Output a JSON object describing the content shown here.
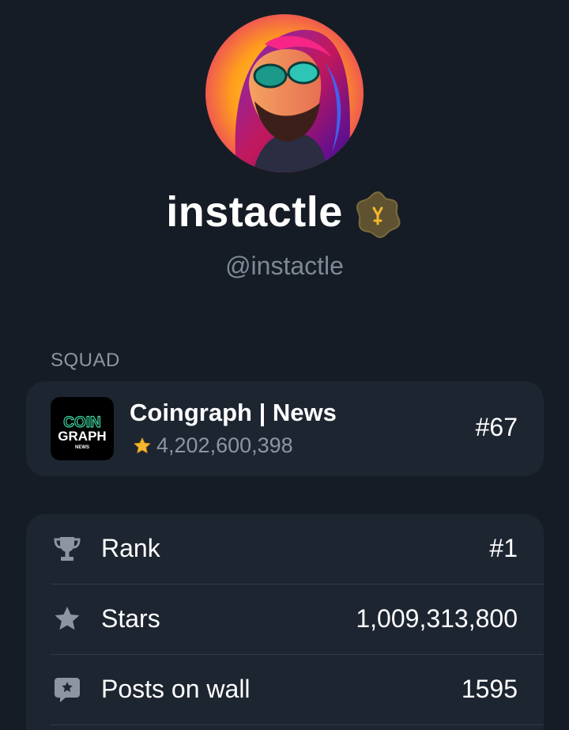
{
  "profile": {
    "display_name": "instactle",
    "handle": "@instactle",
    "avatar_icon": "portrait-avatar",
    "badge_icon": "gold-star-badge-icon"
  },
  "squad": {
    "section_label": "SQUAD",
    "name": "Coingraph | News",
    "stars": "4,202,600,398",
    "rank": "#67",
    "logo": {
      "line1": "COIN",
      "line2": "GRAPH",
      "line3": "NEWS"
    }
  },
  "stats": [
    {
      "icon": "trophy-icon",
      "label": "Rank",
      "value": "#1"
    },
    {
      "icon": "star-icon",
      "label": "Stars",
      "value": "1,009,313,800"
    },
    {
      "icon": "chat-star-icon",
      "label": "Posts on wall",
      "value": "1595"
    }
  ],
  "colors": {
    "background": "#161c25",
    "card": "#1d2531",
    "muted_text": "#8c95a1",
    "accent_gold": "#f5b82e",
    "logo_green": "#3fd6a0"
  }
}
